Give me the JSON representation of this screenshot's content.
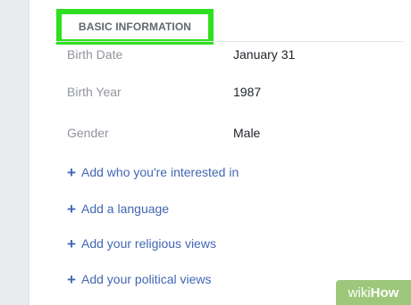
{
  "section": {
    "title": "BASIC INFORMATION"
  },
  "fields": [
    {
      "label": "Birth Date",
      "value": "January 31"
    },
    {
      "label": "Birth Year",
      "value": "1987"
    },
    {
      "label": "Gender",
      "value": "Male"
    }
  ],
  "add_links": [
    {
      "label": "Add who you're interested in",
      "icon": "plus-icon"
    },
    {
      "label": "Add a language",
      "icon": "plus-icon"
    },
    {
      "label": "Add your religious views",
      "icon": "plus-icon"
    },
    {
      "label": "Add your political views",
      "icon": "plus-icon"
    }
  ],
  "watermark": {
    "part1": "wiki",
    "part2": "How"
  },
  "colors": {
    "highlight": "#2ee01f",
    "link": "#4267b2",
    "label": "#90949c",
    "value": "#1d2129",
    "header": "#606770",
    "background": "#e9ebee"
  }
}
